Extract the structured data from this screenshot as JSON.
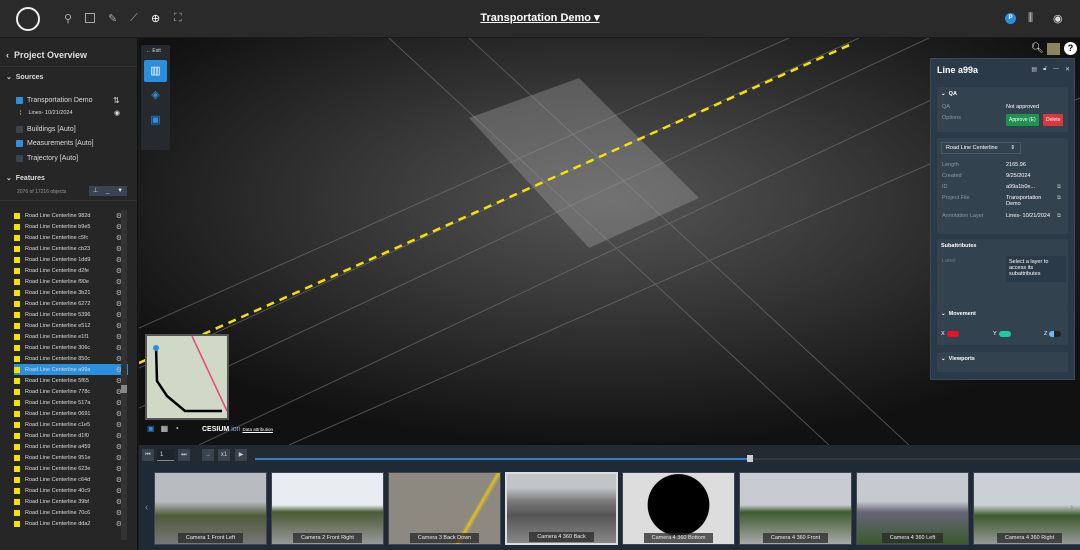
{
  "header": {
    "title": "Transportation Demo",
    "user_initial": "P"
  },
  "left": {
    "back_title": "Project Overview",
    "sources_label": "Sources",
    "sources": [
      {
        "label": "Transportation Demo",
        "checked": true
      },
      {
        "label": "Lines- 10/21/2024",
        "sub": true
      },
      {
        "label": "Buildings [Auto]",
        "checked": false
      },
      {
        "label": "Measurements [Auto]",
        "checked": true
      },
      {
        "label": "Trajectory [Auto]",
        "checked": false
      }
    ],
    "features_label": "Features",
    "count": "2076 of 17216 objects",
    "features": [
      "Road Line Centerline 982d",
      "Road Line Centerline b9e5",
      "Road Line Centerline c5fc",
      "Road Line Centerline cb23",
      "Road Line Centerline 1dd9",
      "Road Line Centerline d2fe",
      "Road Line Centerline f90e",
      "Road Line Centerline 3b21",
      "Road Line Centerline 6272",
      "Road Line Centerline 5396",
      "Road Line Centerline e512",
      "Road Line Centerline e1f1",
      "Road Line Centerline 306c",
      "Road Line Centerline 850c",
      "Road Line Centerline a99a",
      "Road Line Centerline 5f65",
      "Road Line Centerline 778c",
      "Road Line Centerline 517a",
      "Road Line Centerline 0691",
      "Road Line Centerline c1e5",
      "Road Line Centerline d1f0",
      "Road Line Centerline a459",
      "Road Line Centerline 951e",
      "Road Line Centerline 623e",
      "Road Line Centerline c64d",
      "Road Line Centerline 40c9",
      "Road Line Centerline 39bf",
      "Road Line Centerline 70c6",
      "Road Line Centerline dda2"
    ],
    "selected_index": 14
  },
  "viewport": {
    "exit_label": "Exit",
    "cesium": "CESIUM",
    "ion": "ion",
    "attribution": "Data attribution"
  },
  "panel": {
    "title": "Line a99a",
    "qa_header": "QA",
    "qa_label": "QA",
    "qa_value": "Not approved",
    "options_label": "Options",
    "approve": "Approve (E)",
    "delete": "Delete",
    "layer_select": "Road Line Centerline",
    "props": [
      {
        "k": "Length",
        "v": "2165.96"
      },
      {
        "k": "Created",
        "v": "9/25/2024"
      },
      {
        "k": "ID",
        "v": "a99a1b0e..."
      },
      {
        "k": "Project File",
        "v": "Transportation Demo"
      },
      {
        "k": "Annotation Layer",
        "v": "Lines- 10/21/2024"
      }
    ],
    "subattr_header": "Subattributes",
    "label_key": "Label",
    "subattr_select": "Select a layer to access its subattributes",
    "movement_header": "Movement",
    "x": "X",
    "y": "Y",
    "z": "Z",
    "viewports_header": "Viewports"
  },
  "timeline": {
    "frame": "1",
    "speed": "x1",
    "progress": 0.6
  },
  "cameras": [
    "Camera 1 Front Left",
    "Camera 2 Front Right",
    "Camera 3 Back Down",
    "Camera 4 360 Back",
    "Camera 4 360 Bottom",
    "Camera 4 360 Front",
    "Camera 4 360 Left",
    "Camera 4 360 Right"
  ],
  "colors": {
    "accent": "#2a8fdc",
    "approve": "#1f9150",
    "delete": "#d9363e",
    "feature": "#f3e300"
  }
}
